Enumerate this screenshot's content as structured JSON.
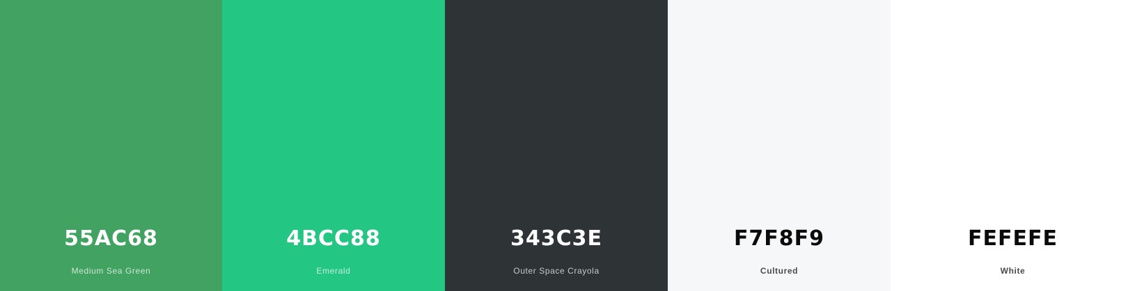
{
  "palette": {
    "swatches": [
      {
        "hex": "55AC68",
        "name": "Medium Sea Green",
        "color": "#42a262",
        "text_tone": "light"
      },
      {
        "hex": "4BCC88",
        "name": "Emerald",
        "color": "#24c684",
        "text_tone": "light"
      },
      {
        "hex": "343C3E",
        "name": "Outer Space Crayola",
        "color": "#2e3436",
        "text_tone": "light"
      },
      {
        "hex": "F7F8F9",
        "name": "Cultured",
        "color": "#f6f7f9",
        "text_tone": "dark"
      },
      {
        "hex": "FEFEFE",
        "name": "White",
        "color": "#ffffff",
        "text_tone": "dark"
      }
    ]
  }
}
